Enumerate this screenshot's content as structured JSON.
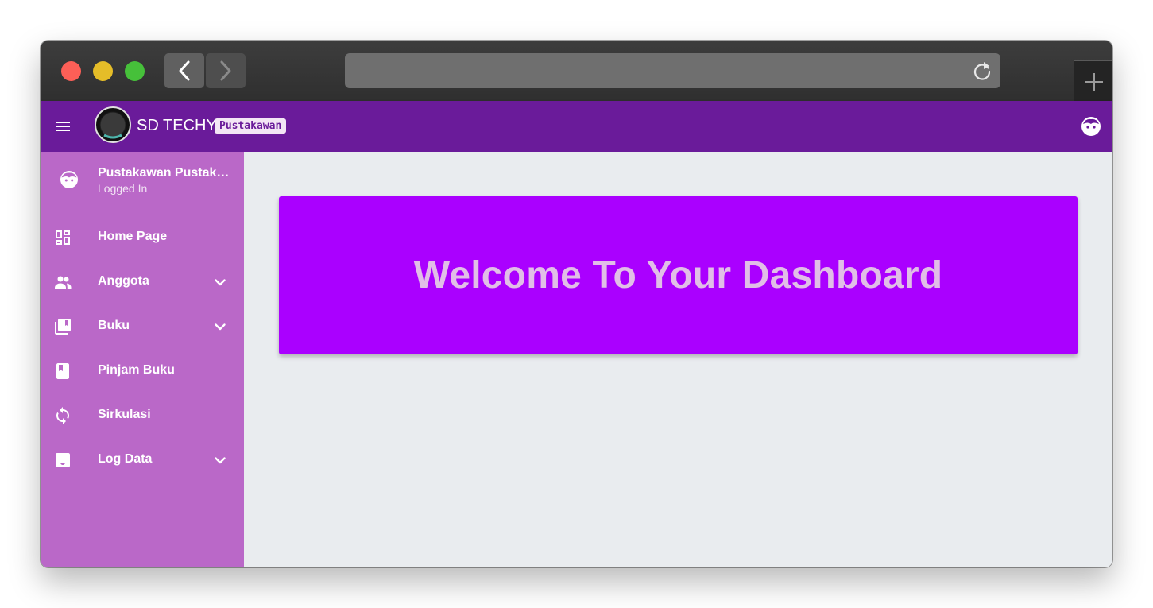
{
  "app": {
    "brand": "SD TECHY",
    "role_badge": "Pustakawan"
  },
  "sidebar": {
    "user": {
      "name": "Pustakawan Pustakawan",
      "status": "Logged In"
    },
    "items": [
      {
        "label": "Home Page",
        "icon": "dashboard-icon",
        "expandable": false
      },
      {
        "label": "Anggota",
        "icon": "people-icon",
        "expandable": true
      },
      {
        "label": "Buku",
        "icon": "library-books-icon",
        "expandable": true
      },
      {
        "label": "Pinjam Buku",
        "icon": "book-icon",
        "expandable": false
      },
      {
        "label": "Sirkulasi",
        "icon": "sync-icon",
        "expandable": false
      },
      {
        "label": "Log Data",
        "icon": "inbox-icon",
        "expandable": true
      }
    ]
  },
  "main": {
    "welcome_title": "Welcome To Your Dashboard"
  },
  "colors": {
    "appbar": "#6a1b9a",
    "sidebar": "#ba68c8",
    "card": "#aa00ff",
    "card_text": "#e1bee7",
    "content_bg": "#e9ecef"
  }
}
